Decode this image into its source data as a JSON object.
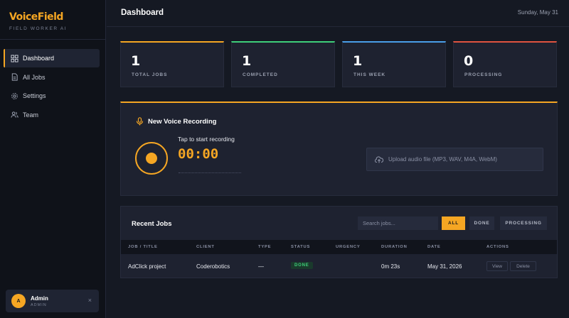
{
  "brand": {
    "name": "VoiceField",
    "subtitle": "FIELD WORKER AI"
  },
  "nav": [
    {
      "label": "Dashboard",
      "icon": "grid-icon",
      "active": true
    },
    {
      "label": "All Jobs",
      "icon": "document-icon"
    },
    {
      "label": "Settings",
      "icon": "gear-icon"
    },
    {
      "label": "Team",
      "icon": "users-icon"
    }
  ],
  "user": {
    "initial": "A",
    "name": "Admin",
    "role": "ADMIN",
    "close_icon": "×"
  },
  "header": {
    "title": "Dashboard",
    "date": "Sunday, May 31"
  },
  "stats": [
    {
      "value": "1",
      "label": "TOTAL JOBS",
      "color": "#f5a623"
    },
    {
      "value": "1",
      "label": "COMPLETED",
      "color": "#3ecf7a"
    },
    {
      "value": "1",
      "label": "THIS WEEK",
      "color": "#4a9ee8"
    },
    {
      "value": "0",
      "label": "PROCESSING",
      "color": "#e0533f"
    }
  ],
  "recording": {
    "title": "New Voice Recording",
    "hint": "Tap to start recording",
    "timer": "00:00",
    "upload_label": "Upload audio file (MP3, WAV, M4A, WebM)"
  },
  "jobs": {
    "title": "Recent Jobs",
    "search_placeholder": "Search jobs...",
    "filters": [
      "ALL",
      "DONE",
      "PROCESSING"
    ],
    "active_filter": "ALL",
    "columns": [
      "JOB / TITLE",
      "CLIENT",
      "TYPE",
      "STATUS",
      "URGENCY",
      "DURATION",
      "DATE",
      "ACTIONS"
    ],
    "rows": [
      {
        "title": "AdClick project",
        "client": "Coderobotics",
        "type": "—",
        "status": "DONE",
        "urgency": "",
        "duration": "0m 23s",
        "date": "May 31, 2026",
        "actions": [
          "View",
          "Delete"
        ]
      }
    ]
  },
  "colors": {
    "accent": "#f5a623",
    "success": "#3ecf7a",
    "info": "#4a9ee8",
    "danger": "#e0533f"
  }
}
